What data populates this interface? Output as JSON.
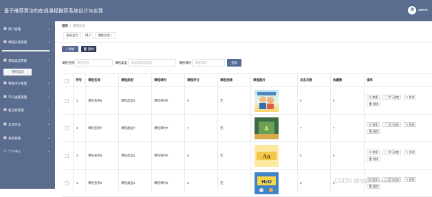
{
  "header": {
    "app_title": "基于推荐算法的在线课程推荐系统设计与实现",
    "admin_name": "admin"
  },
  "sidebar": {
    "items": [
      {
        "label": "用户管理",
        "icon": "grid-icon"
      },
      {
        "label": "课程信息管理",
        "icon": "grid-icon"
      },
      {
        "label": "课程类型管理",
        "icon": "grid-icon",
        "open": true,
        "sub": [
          "课程类型"
        ]
      },
      {
        "label": "课程评价管理",
        "icon": "grid-icon"
      },
      {
        "label": "学习进度管理",
        "icon": "grid-icon"
      },
      {
        "label": "留言板管理",
        "icon": "grid-icon"
      },
      {
        "label": "互动交流",
        "icon": "grid-icon"
      },
      {
        "label": "系统管理",
        "icon": "grid-icon"
      },
      {
        "label": "个人中心",
        "icon": "calendar-icon"
      }
    ]
  },
  "breadcrumb": {
    "home": "首页",
    "sep": "//",
    "current": "课程信息"
  },
  "tabs": [
    {
      "label": "系统首页"
    },
    {
      "label": "用户"
    },
    {
      "label": "课程信息",
      "closable": true
    }
  ],
  "toolbar": {
    "add_label": "+ 添加",
    "delete_label": "删除"
  },
  "filters": {
    "name_label": "课程名称",
    "name_placeholder": "课程名称",
    "type_label": "课程类型",
    "type_placeholder": "请选择课程类型",
    "time_label": "课程课时",
    "time_placeholder": "课程课时",
    "search_label": "查询"
  },
  "table": {
    "headers": [
      "序号",
      "课程名称",
      "课程类型",
      "课程课时",
      "课程评分",
      "课程视频",
      "课程图片",
      "点击次数",
      "收藏数",
      "操作"
    ],
    "rows": [
      {
        "index": "1",
        "name": "课程名称8",
        "type": "课程类型8",
        "hours": "课程课时8",
        "score": "8",
        "video": "无",
        "image": "cartoon-cover",
        "clicks": "8",
        "favorites": "6"
      },
      {
        "index": "2",
        "name": "课程名称7",
        "type": "课程类型7",
        "hours": "课程课时7",
        "score": "7",
        "video": "无",
        "image": "art-cover",
        "clicks": "7",
        "favorites": "7"
      },
      {
        "index": "3",
        "name": "课程名称6",
        "type": "课程类型6",
        "hours": "课程课时6",
        "score": "6",
        "video": "无",
        "image": "calligraphy-cover",
        "clicks": "6",
        "favorites": "5"
      },
      {
        "index": "4",
        "name": "课程名称5",
        "type": "课程类型5",
        "hours": "课程课时5",
        "score": "5",
        "video": "无",
        "image": "chemistry-cover",
        "clicks": "5",
        "favorites": "5"
      }
    ],
    "actions": {
      "view": "查看",
      "progress": "学习进度",
      "edit": "修改",
      "delete": "删除"
    }
  },
  "watermark": "CSDN @qq1694456187",
  "colors": {
    "sidebar": "#5b6d8f",
    "primary": "#556a97",
    "danger_btn": "#2e3b58"
  }
}
